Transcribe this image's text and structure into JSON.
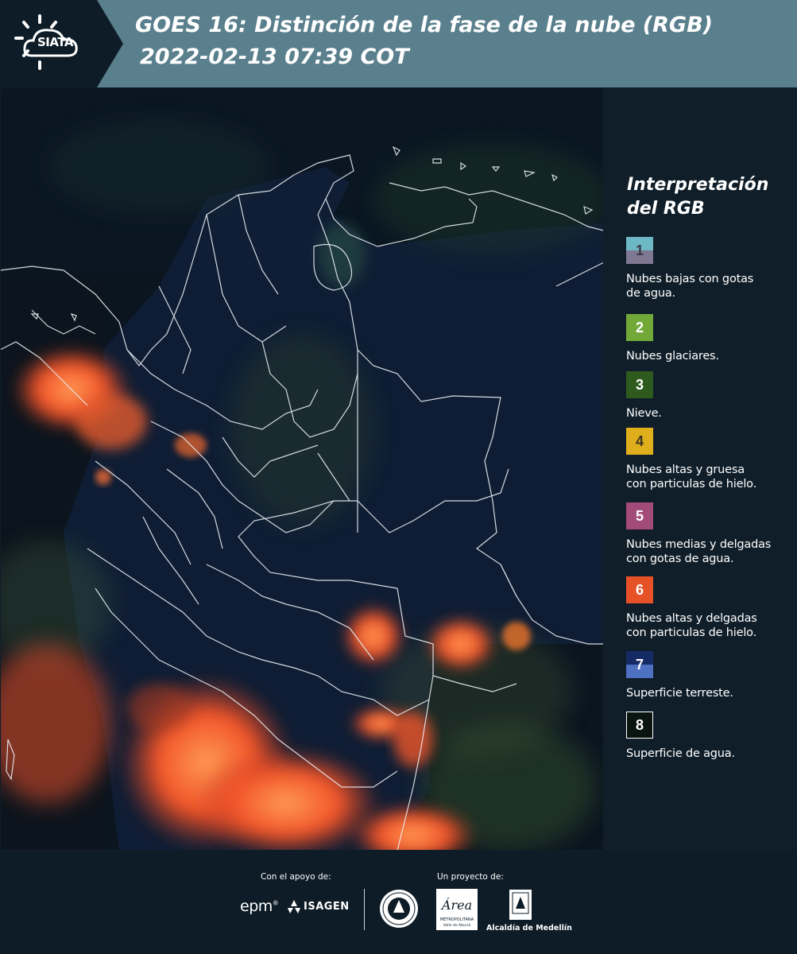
{
  "header": {
    "logo_text": "SIATA",
    "title_line1": "GOES 16: Distinción de la fase de la nube (RGB)",
    "title_line2": "2022-02-13 07:39 COT"
  },
  "legend": {
    "title_line1": "Interpretación",
    "title_line2": "del RGB",
    "items": [
      {
        "number": "1",
        "label_lines": [
          "Nubes bajas con gotas",
          "de agua."
        ],
        "color_top": "#6cb8c4",
        "color_bottom": "#7e7893",
        "text_color": "#3b3b4a"
      },
      {
        "number": "2",
        "label_lines": [
          "Nubes glaciares."
        ],
        "color_top": "#72a838",
        "color_bottom": "#72a838",
        "text_color": "#ffffff"
      },
      {
        "number": "3",
        "label_lines": [
          "Nieve."
        ],
        "color_top": "#2f5a1d",
        "color_bottom": "#2f5a1d",
        "text_color": "#ffffff"
      },
      {
        "number": "4",
        "label_lines": [
          "Nubes altas y gruesa",
          "con particulas de hielo."
        ],
        "color_top": "#deae1c",
        "color_bottom": "#deae1c",
        "text_color": "#3b3322"
      },
      {
        "number": "5",
        "label_lines": [
          "Nubes medias y delgadas",
          "con gotas de agua."
        ],
        "color_top": "#a24b7a",
        "color_bottom": "#a24b7a",
        "text_color": "#ffffff"
      },
      {
        "number": "6",
        "label_lines": [
          "Nubes altas y delgadas",
          "con particulas de hielo."
        ],
        "color_top": "#e65128",
        "color_bottom": "#e65128",
        "text_color": "#ffffff"
      },
      {
        "number": "7",
        "label_lines": [
          "Superficie terreste."
        ],
        "color_top": "#162a66",
        "color_bottom": "#4e71c2",
        "text_color": "#ffffff"
      },
      {
        "number": "8",
        "label_lines": [
          "Superficie de agua."
        ],
        "color_top": "#0a1410",
        "color_bottom": "#0a1410",
        "text_color": "#ffffff"
      }
    ]
  },
  "footer": {
    "support_label": "Con el apoyo de:",
    "project_label": "Un proyecto de:",
    "epm_logo": "epm",
    "isagen_logo": "ISAGEN",
    "area_logo": "Área",
    "area_sub1": "METROPOLITANA",
    "area_sub2": "Valle de Aburrá",
    "alcaldia_label": "Alcaldía de Medellín"
  },
  "colors": {
    "header_bg": "#5a7f8d",
    "panel_bg": "#0f1e29",
    "page_bg": "#0d1c27"
  }
}
